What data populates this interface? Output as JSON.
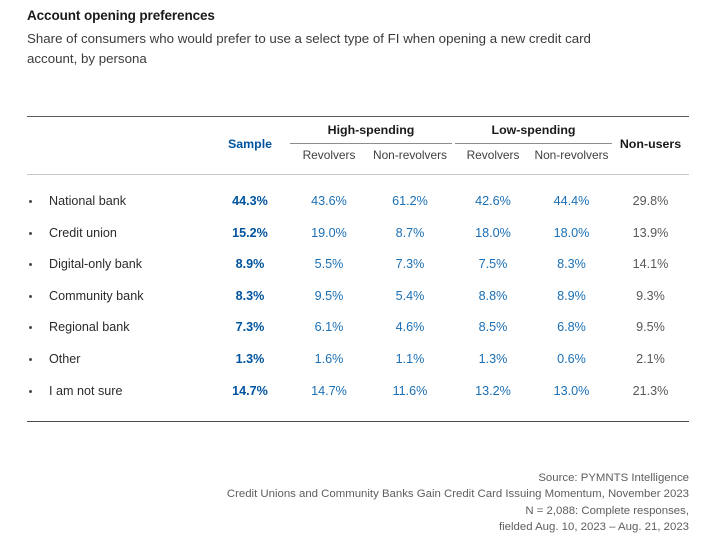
{
  "title": "Account opening preferences",
  "subtitle": "Share of consumers who would prefer to use a select type of FI when opening a new credit card account, by persona",
  "table": {
    "sample_header": "Sample",
    "nonusers_header": "Non-users",
    "groups": [
      {
        "label": "High-spending",
        "sub": [
          "Revolvers",
          "Non-revolvers"
        ]
      },
      {
        "label": "Low-spending",
        "sub": [
          "Revolvers",
          "Non-revolvers"
        ]
      }
    ],
    "rows": [
      {
        "label": "National bank",
        "sample": "44.3%",
        "hs_rev": "43.6%",
        "hs_nonrev": "61.2%",
        "ls_rev": "42.6%",
        "ls_nonrev": "44.4%",
        "nonusers": "29.8%"
      },
      {
        "label": "Credit union",
        "sample": "15.2%",
        "hs_rev": "19.0%",
        "hs_nonrev": "8.7%",
        "ls_rev": "18.0%",
        "ls_nonrev": "18.0%",
        "nonusers": "13.9%"
      },
      {
        "label": "Digital-only bank",
        "sample": "8.9%",
        "hs_rev": "5.5%",
        "hs_nonrev": "7.3%",
        "ls_rev": "7.5%",
        "ls_nonrev": "8.3%",
        "nonusers": "14.1%"
      },
      {
        "label": "Community bank",
        "sample": "8.3%",
        "hs_rev": "9.5%",
        "hs_nonrev": "5.4%",
        "ls_rev": "8.8%",
        "ls_nonrev": "8.9%",
        "nonusers": "9.3%"
      },
      {
        "label": "Regional bank",
        "sample": "7.3%",
        "hs_rev": "6.1%",
        "hs_nonrev": "4.6%",
        "ls_rev": "8.5%",
        "ls_nonrev": "6.8%",
        "nonusers": "9.5%"
      },
      {
        "label": "Other",
        "sample": "1.3%",
        "hs_rev": "1.6%",
        "hs_nonrev": "1.1%",
        "ls_rev": "1.3%",
        "ls_nonrev": "0.6%",
        "nonusers": "2.1%"
      },
      {
        "label": "I am not sure",
        "sample": "14.7%",
        "hs_rev": "14.7%",
        "hs_nonrev": "11.6%",
        "ls_rev": "13.2%",
        "ls_nonrev": "13.0%",
        "nonusers": "21.3%"
      }
    ]
  },
  "footer": {
    "line1": "Source: PYMNTS Intelligence",
    "line2": "Credit Unions and Community Banks Gain Credit Card Issuing Momentum, November 2023",
    "line3": "N = 2,088: Complete responses,",
    "line4": "fielded Aug. 10, 2023 – Aug. 21, 2023"
  },
  "colors": {
    "sample_blue": "#00549f",
    "value_blue": "#1a6fb5",
    "nonusers_gray": "#58595b",
    "title_black": "#1a1a1a"
  },
  "chart_data": {
    "type": "table",
    "title": "Account opening preferences",
    "subtitle": "Share of consumers who would prefer to use a select type of FI when opening a new credit card account, by persona",
    "columns": [
      "Sample",
      "High-spending Revolvers",
      "High-spending Non-revolvers",
      "Low-spending Revolvers",
      "Low-spending Non-revolvers",
      "Non-users"
    ],
    "categories": [
      "National bank",
      "Credit union",
      "Digital-only bank",
      "Community bank",
      "Regional bank",
      "Other",
      "I am not sure"
    ],
    "series": [
      {
        "name": "Sample",
        "values": [
          44.3,
          15.2,
          8.9,
          8.3,
          7.3,
          1.3,
          14.7
        ]
      },
      {
        "name": "High-spending Revolvers",
        "values": [
          43.6,
          19.0,
          5.5,
          9.5,
          6.1,
          1.6,
          14.7
        ]
      },
      {
        "name": "High-spending Non-revolvers",
        "values": [
          61.2,
          8.7,
          7.3,
          5.4,
          4.6,
          1.1,
          11.6
        ]
      },
      {
        "name": "Low-spending Revolvers",
        "values": [
          42.6,
          18.0,
          7.5,
          8.8,
          8.5,
          1.3,
          13.2
        ]
      },
      {
        "name": "Low-spending Non-revolvers",
        "values": [
          44.4,
          18.0,
          8.3,
          8.9,
          6.8,
          0.6,
          13.0
        ]
      },
      {
        "name": "Non-users",
        "values": [
          29.8,
          13.9,
          14.1,
          9.3,
          9.5,
          2.1,
          21.3
        ]
      }
    ],
    "unit": "percent",
    "xlabel": "",
    "ylabel": ""
  }
}
